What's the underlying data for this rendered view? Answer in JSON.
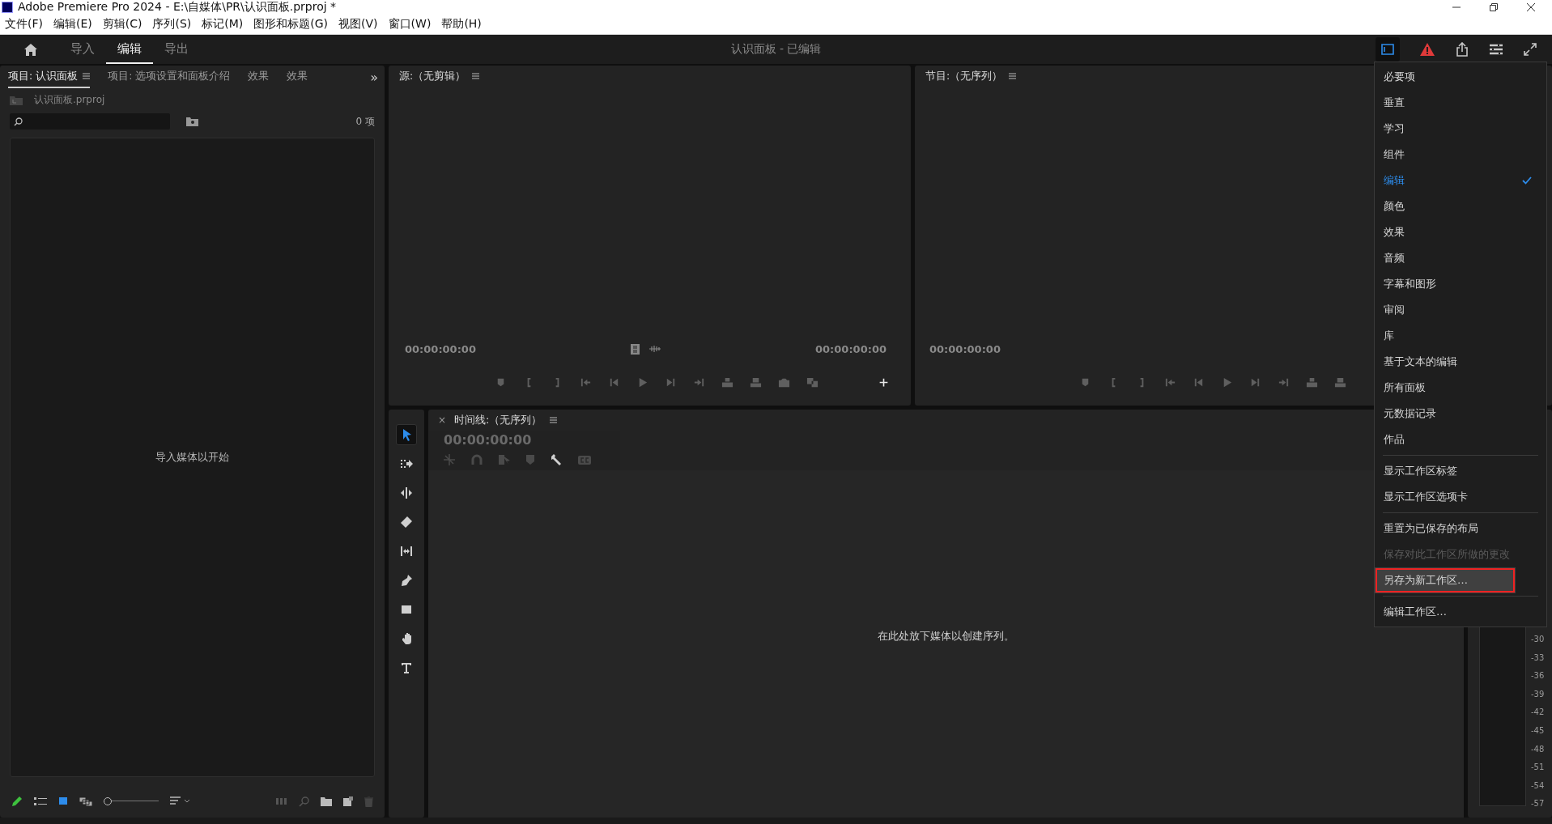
{
  "window": {
    "title": "Adobe Premiere Pro 2024 - E:\\自媒体\\PR\\认识面板.prproj *"
  },
  "menu_bar": [
    "文件(F)",
    "编辑(E)",
    "剪辑(C)",
    "序列(S)",
    "标记(M)",
    "图形和标题(G)",
    "视图(V)",
    "窗口(W)",
    "帮助(H)"
  ],
  "header": {
    "tabs": [
      {
        "label": "导入",
        "selected": false
      },
      {
        "label": "编辑",
        "selected": true
      },
      {
        "label": "导出",
        "selected": false
      }
    ],
    "project_title": "认识面板 - 已编辑"
  },
  "project_panel": {
    "tabs": [
      {
        "label": "项目: 认识面板",
        "selected": true
      },
      {
        "label": "项目: 选项设置和面板介绍",
        "selected": false
      },
      {
        "label": "效果",
        "selected": false
      },
      {
        "label": "效果",
        "selected": false
      }
    ],
    "overflow": "»",
    "file": "认识面板.prproj",
    "item_count": "0 项",
    "empty_message": "导入媒体以开始",
    "zoom_slider": {
      "level": 0
    }
  },
  "source_monitor": {
    "title": "源:（无剪辑）",
    "timecode_left": "00:00:00:00",
    "timecode_right": "00:00:00:00"
  },
  "program_monitor": {
    "title": "节目:（无序列）",
    "timecode": "00:00:00:00"
  },
  "tools": [
    {
      "kind": "selection",
      "selected": true
    },
    {
      "kind": "track-select",
      "selected": false
    },
    {
      "kind": "ripple",
      "selected": false
    },
    {
      "kind": "razor",
      "selected": false
    },
    {
      "kind": "slip",
      "selected": false
    },
    {
      "kind": "pen",
      "selected": false
    },
    {
      "kind": "rectangle",
      "selected": false
    },
    {
      "kind": "hand",
      "selected": false
    },
    {
      "kind": "type",
      "selected": false
    }
  ],
  "timeline": {
    "close": "×",
    "title": "时间线:（无序列）",
    "timecode": "00:00:00:00",
    "drop_message": "在此处放下媒体以创建序列。"
  },
  "audio_meter": {
    "ticks": [
      "-30",
      "-33",
      "-36",
      "-39",
      "-42",
      "-45",
      "-48",
      "-51",
      "-54",
      "-57"
    ]
  },
  "workspace_menu": {
    "open": true,
    "groups": [
      [
        {
          "label": "必要项",
          "selected": false,
          "disabled": false,
          "highlighted": false
        },
        {
          "label": "垂直",
          "selected": false,
          "disabled": false,
          "highlighted": false
        },
        {
          "label": "学习",
          "selected": false,
          "disabled": false,
          "highlighted": false
        },
        {
          "label": "组件",
          "selected": false,
          "disabled": false,
          "highlighted": false
        },
        {
          "label": "编辑",
          "selected": true,
          "disabled": false,
          "highlighted": false
        },
        {
          "label": "颜色",
          "selected": false,
          "disabled": false,
          "highlighted": false
        },
        {
          "label": "效果",
          "selected": false,
          "disabled": false,
          "highlighted": false
        },
        {
          "label": "音频",
          "selected": false,
          "disabled": false,
          "highlighted": false
        },
        {
          "label": "字幕和图形",
          "selected": false,
          "disabled": false,
          "highlighted": false
        },
        {
          "label": "审阅",
          "selected": false,
          "disabled": false,
          "highlighted": false
        },
        {
          "label": "库",
          "selected": false,
          "disabled": false,
          "highlighted": false
        },
        {
          "label": "基于文本的编辑",
          "selected": false,
          "disabled": false,
          "highlighted": false
        },
        {
          "label": "所有面板",
          "selected": false,
          "disabled": false,
          "highlighted": false
        },
        {
          "label": "元数据记录",
          "selected": false,
          "disabled": false,
          "highlighted": false
        },
        {
          "label": "作品",
          "selected": false,
          "disabled": false,
          "highlighted": false
        }
      ],
      [
        {
          "label": "显示工作区标签",
          "selected": false,
          "disabled": false,
          "highlighted": false
        },
        {
          "label": "显示工作区选项卡",
          "selected": false,
          "disabled": false,
          "highlighted": false
        }
      ],
      [
        {
          "label": "重置为已保存的布局",
          "selected": false,
          "disabled": false,
          "highlighted": false
        },
        {
          "label": "保存对此工作区所做的更改",
          "selected": false,
          "disabled": true,
          "highlighted": false
        },
        {
          "label": "另存为新工作区…",
          "selected": false,
          "disabled": false,
          "highlighted": true
        }
      ],
      [
        {
          "label": "编辑工作区…",
          "selected": false,
          "disabled": false,
          "highlighted": false
        }
      ]
    ]
  }
}
